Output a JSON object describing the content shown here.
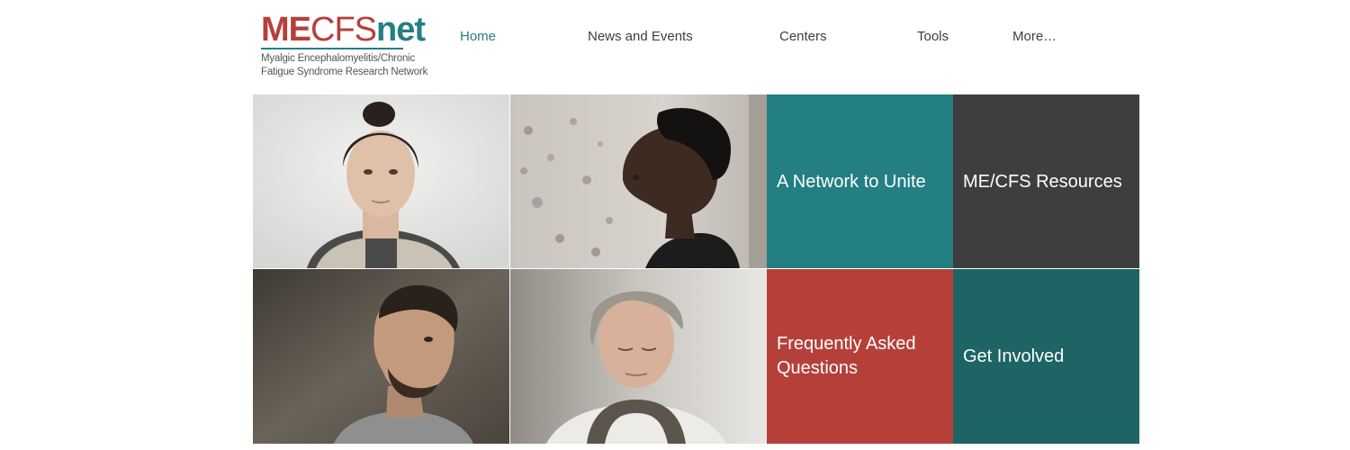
{
  "logo": {
    "me": "ME",
    "cfs": "CFS",
    "net": "net",
    "tagline_line1": "Myalgic Encephalomyelitis/Chronic",
    "tagline_line2": "Fatigue Syndrome Research Network"
  },
  "nav": {
    "items": [
      {
        "label": "Home",
        "active": true
      },
      {
        "label": "News and Events",
        "active": false
      },
      {
        "label": "Centers",
        "active": false
      },
      {
        "label": "Tools",
        "active": false
      },
      {
        "label": "More…",
        "active": false
      }
    ]
  },
  "tiles": {
    "network": {
      "line1": "A Network to Unite",
      "color": "#247f83"
    },
    "resources": {
      "line1": "ME/CFS Resources",
      "color": "#3e3e3e"
    },
    "faq": {
      "line1": "Frequently Asked",
      "line2": "Questions",
      "color": "#b5403a"
    },
    "involved": {
      "line1": "Get Involved",
      "color": "#1e6464"
    }
  },
  "colors": {
    "accent_teal": "#247f83",
    "accent_red": "#b5403a",
    "nav_text": "#3f3f3f"
  }
}
